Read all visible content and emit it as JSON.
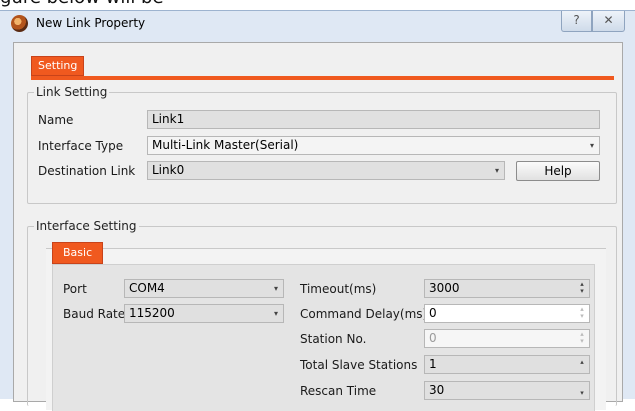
{
  "caption": "gure below will be",
  "window": {
    "title": "New Link Property",
    "help_glyph": "?",
    "close_glyph": "✕"
  },
  "tabs": {
    "setting": "Setting",
    "basic": "Basic"
  },
  "link_setting": {
    "legend": "Link Setting",
    "name_label": "Name",
    "name_value": "Link1",
    "interface_type_label": "Interface Type",
    "interface_type_value": "Multi-Link Master(Serial)",
    "destination_link_label": "Destination Link",
    "destination_link_value": "Link0",
    "help_button": "Help"
  },
  "interface_setting": {
    "legend": "Interface Setting",
    "port_label": "Port",
    "port_value": "COM4",
    "baud_rate_label": "Baud Rate",
    "baud_rate_value": "115200",
    "timeout_label": "Timeout(ms)",
    "timeout_value": "3000",
    "command_delay_label": "Command Delay(ms)",
    "command_delay_value": "0",
    "station_no_label": "Station No.",
    "station_no_value": "0",
    "total_slave_label": "Total Slave Stations",
    "total_slave_value": "1",
    "rescan_time_label": "Rescan Time",
    "rescan_time_value": "30"
  },
  "icons": {
    "dropdown_arrow": "▾",
    "spin_up": "▴",
    "spin_down": "▾"
  }
}
